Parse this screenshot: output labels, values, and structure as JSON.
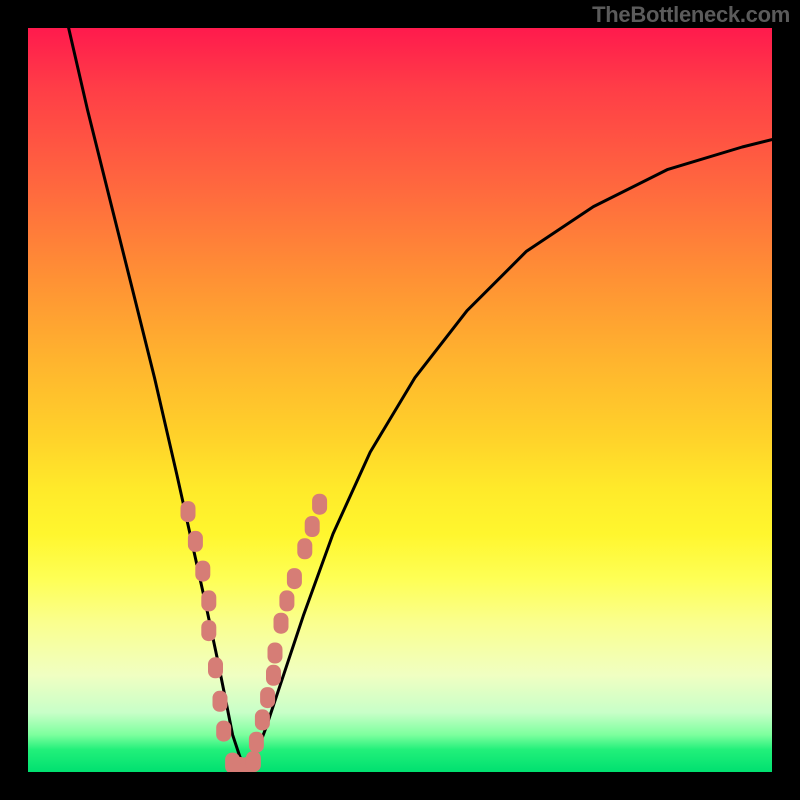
{
  "attribution": "TheBottleneck.com",
  "chart_data": {
    "type": "line",
    "title": "",
    "xlabel": "",
    "ylabel": "",
    "xlim": [
      0,
      100
    ],
    "ylim": [
      0,
      100
    ],
    "curve": {
      "x": [
        5,
        8,
        11,
        14,
        17,
        20,
        22,
        24,
        25.5,
        26.5,
        27.5,
        28.5,
        29.5,
        30.5,
        32,
        34,
        37,
        41,
        46,
        52,
        59,
        67,
        76,
        86,
        96,
        100
      ],
      "y": [
        102,
        89,
        77,
        65,
        53,
        40,
        31,
        22,
        15,
        10,
        5,
        2,
        0,
        2,
        6,
        12,
        21,
        32,
        43,
        53,
        62,
        70,
        76,
        81,
        84,
        85
      ]
    },
    "marker_clusters": [
      {
        "side": "left",
        "x": [
          21.5,
          22.5,
          23.5,
          24.3,
          24.3,
          25.2,
          25.8,
          26.3
        ],
        "y": [
          35,
          31,
          27,
          23,
          19,
          14,
          9.5,
          5.5
        ]
      },
      {
        "side": "right",
        "x": [
          30.7,
          31.5,
          32.2,
          33.0,
          33.2,
          34.0,
          34.8,
          35.8,
          37.2,
          38.2,
          39.2
        ],
        "y": [
          4,
          7,
          10,
          13,
          16,
          20,
          23,
          26,
          30,
          33,
          36
        ]
      },
      {
        "side": "bottom",
        "x": [
          27.5,
          28.5,
          29.5,
          30.3
        ],
        "y": [
          1.2,
          0.6,
          0.6,
          1.4
        ]
      }
    ],
    "colors": {
      "curve": "#000000",
      "markers": "#d67d76"
    }
  }
}
